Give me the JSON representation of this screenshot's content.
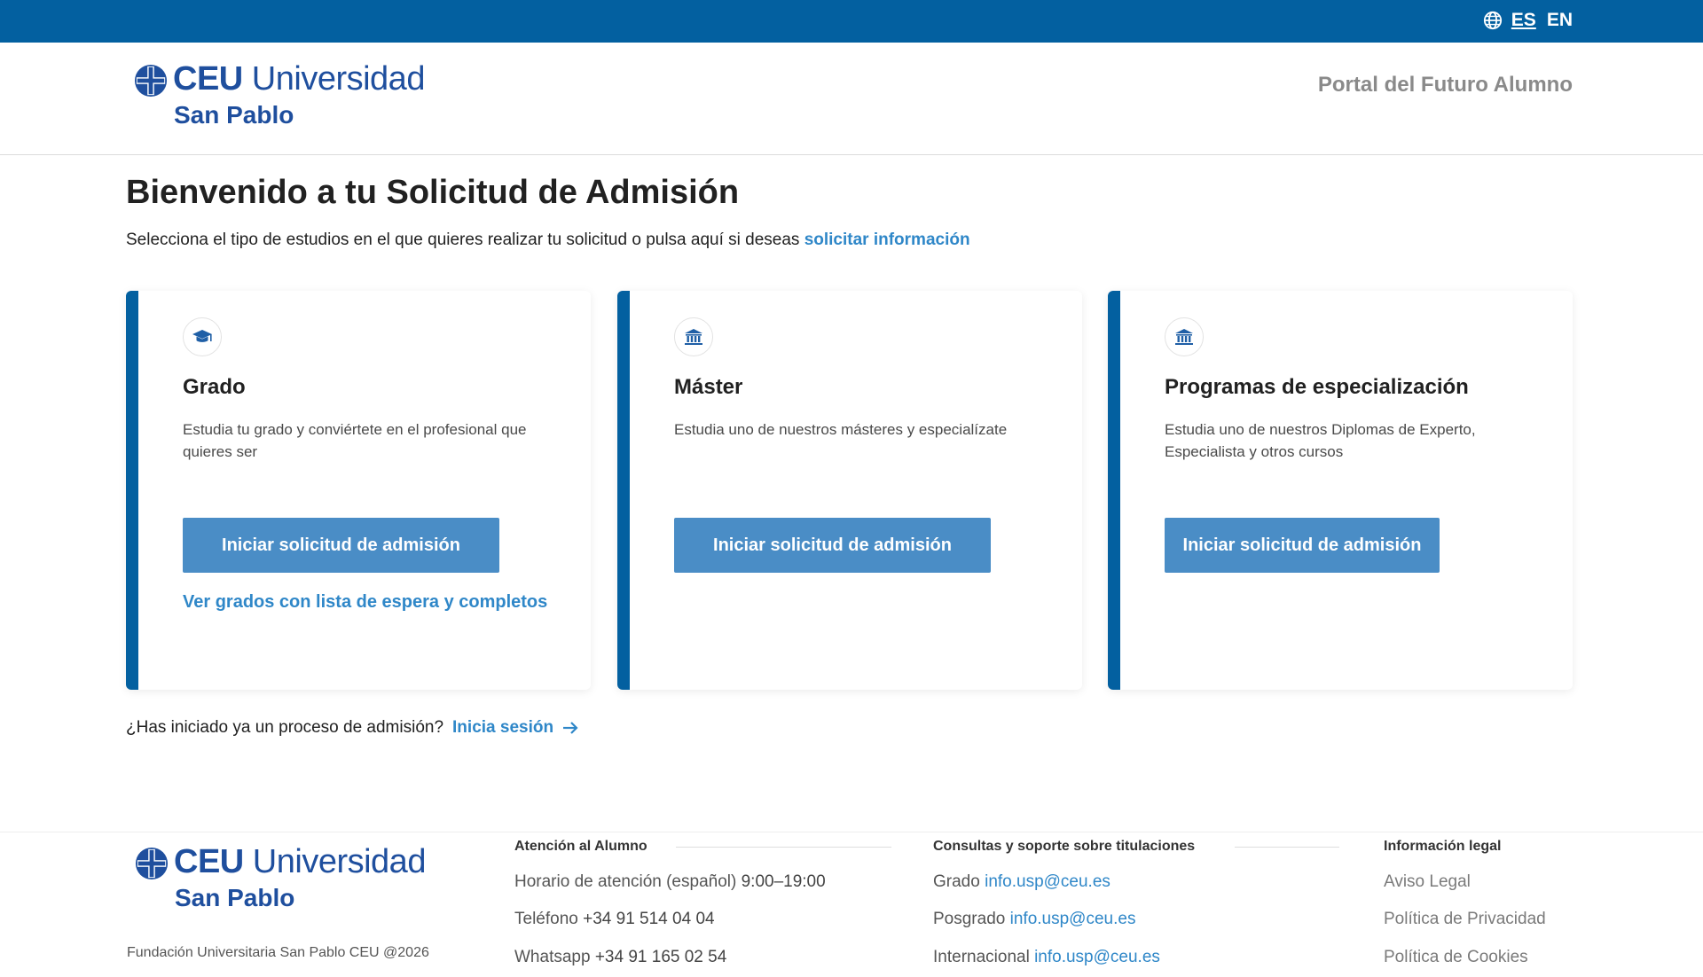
{
  "topbar": {
    "lang_es": "ES",
    "lang_en": "EN",
    "globe_icon": "globe-icon"
  },
  "header": {
    "logo": {
      "brand": "CEU",
      "name": "Universidad",
      "campus": "San Pablo"
    },
    "portal_link": "Portal del Futuro Alumno"
  },
  "main": {
    "title": "Bienvenido a tu Solicitud de Admisión",
    "intro_text": "Selecciona el tipo de estudios en el que quieres realizar tu solicitud o pulsa aquí si deseas",
    "intro_link": "solicitar información",
    "cards": [
      {
        "icon": "graduation-cap-icon",
        "title": "Grado",
        "description": "Estudia tu grado y conviértete en el profesional que quieres ser",
        "button": "Iniciar solicitud de admisión",
        "link": "Ver grados con lista de espera y completos"
      },
      {
        "icon": "institution-icon",
        "title": "Máster",
        "description": "Estudia uno de nuestros másteres y especialízate",
        "button": "Iniciar solicitud de admisión"
      },
      {
        "icon": "institution-icon",
        "title": "Programas de especialización",
        "description": "Estudia uno de nuestros Diplomas de Experto, Especialista y otros cursos",
        "button": "Iniciar solicitud de admisión"
      }
    ],
    "login_prompt": "¿Has iniciado ya un proceso de admisión?",
    "login_link": "Inicia sesión"
  },
  "footer": {
    "logo": {
      "brand": "CEU",
      "name": "Universidad",
      "campus": "San Pablo"
    },
    "copyright": "Fundación Universitaria San Pablo CEU @2026",
    "atencion": {
      "title": "Atención al Alumno",
      "horario_label": "Horario de atención (español)",
      "horario_value": "9:00–19:00",
      "telefono_label": "Teléfono",
      "telefono_value": "+34 91 514 04 04",
      "whatsapp_label": "Whatsapp",
      "whatsapp_value": "+34 91 165 02 54"
    },
    "consultas": {
      "title": "Consultas y soporte sobre titulaciones",
      "grado_label": "Grado",
      "grado_email": "info.usp@ceu.es",
      "posgrado_label": "Posgrado",
      "posgrado_email": "info.usp@ceu.es",
      "internacional_label": "Internacional",
      "internacional_email": "info.usp@ceu.es"
    },
    "legal": {
      "title": "Información legal",
      "aviso": "Aviso Legal",
      "privacidad": "Política de Privacidad",
      "cookies": "Política de Cookies"
    }
  },
  "colors": {
    "brand_blue": "#0360a0",
    "button_blue": "#4a8dc6",
    "link_blue": "#2f87c8",
    "logo_blue": "#1f4f9e"
  }
}
